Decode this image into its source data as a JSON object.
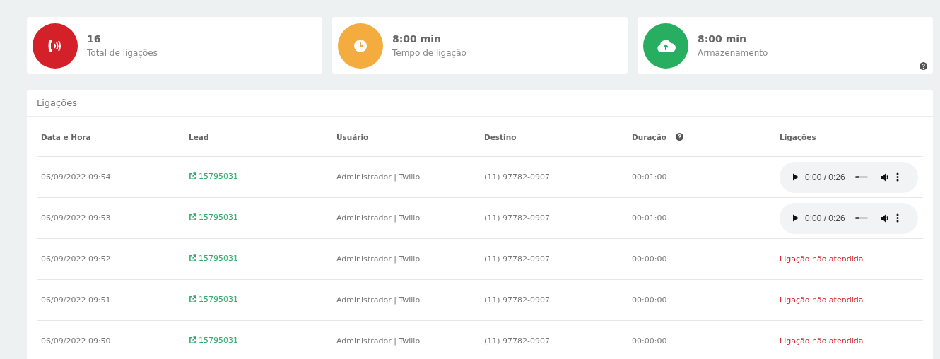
{
  "stats": [
    {
      "kind": "phone",
      "color": "#d32029",
      "value": "16",
      "label": "Total de ligações",
      "help": false
    },
    {
      "kind": "clock",
      "color": "#f5ac3f",
      "value": "8:00 min",
      "label": "Tempo de ligação",
      "help": false
    },
    {
      "kind": "cloud",
      "color": "#27ae60",
      "value": "8:00 min",
      "label": "Armazenamento",
      "help": true
    }
  ],
  "panel": {
    "title": "Ligações",
    "columns": [
      {
        "label": "Data e Hora",
        "help": false
      },
      {
        "label": "Lead",
        "help": false
      },
      {
        "label": "Usuário",
        "help": false
      },
      {
        "label": "Destino",
        "help": false
      },
      {
        "label": "Duração",
        "help": true
      },
      {
        "label": "Ligações",
        "help": false
      }
    ],
    "rows": [
      {
        "datetime": "06/09/2022 09:54",
        "lead": "15795031",
        "user": "Administrador | Twilio",
        "destination": "(11) 97782-0907",
        "duration": "00:01:00",
        "call": {
          "kind": "audio",
          "time": "0:00 / 0:26",
          "level": 0.35
        }
      },
      {
        "datetime": "06/09/2022 09:53",
        "lead": "15795031",
        "user": "Administrador | Twilio",
        "destination": "(11) 97782-0907",
        "duration": "00:01:00",
        "call": {
          "kind": "audio",
          "time": "0:00 / 0:26",
          "level": 0.35
        }
      },
      {
        "datetime": "06/09/2022 09:52",
        "lead": "15795031",
        "user": "Administrador | Twilio",
        "destination": "(11) 97782-0907",
        "duration": "00:00:00",
        "call": {
          "kind": "missed",
          "text": "Ligação não atendida"
        }
      },
      {
        "datetime": "06/09/2022 09:51",
        "lead": "15795031",
        "user": "Administrador | Twilio",
        "destination": "(11) 97782-0907",
        "duration": "00:00:00",
        "call": {
          "kind": "missed",
          "text": "Ligação não atendida"
        }
      },
      {
        "datetime": "06/09/2022 09:50",
        "lead": "15795031",
        "user": "Administrador | Twilio",
        "destination": "(11) 97782-0907",
        "duration": "00:00:00",
        "call": {
          "kind": "missed",
          "text": "Ligação não atendida"
        }
      }
    ]
  }
}
